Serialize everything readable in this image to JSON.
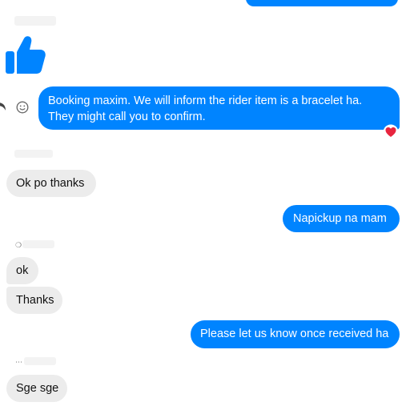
{
  "conversation": {
    "messages": [
      {
        "text": "Booking maxim. We will inform the rider item is a bracelet ha.\nThey might call you to confirm.",
        "side": "outgoing"
      },
      {
        "text": "Ok po thanks",
        "side": "incoming"
      },
      {
        "text": "Napickup na mam",
        "side": "outgoing"
      },
      {
        "text": "ok",
        "side": "incoming"
      },
      {
        "text": "Thanks",
        "side": "incoming"
      },
      {
        "text": "Please let us know once received ha",
        "side": "outgoing"
      },
      {
        "text": "Sge sge",
        "side": "incoming"
      }
    ],
    "reaction_icon": "heart-icon",
    "sticker_icon": "thumbs-up-icon",
    "accent_color": "#0084ff",
    "incoming_bubble_color": "#ececec",
    "reaction_color": "#e8253e"
  }
}
